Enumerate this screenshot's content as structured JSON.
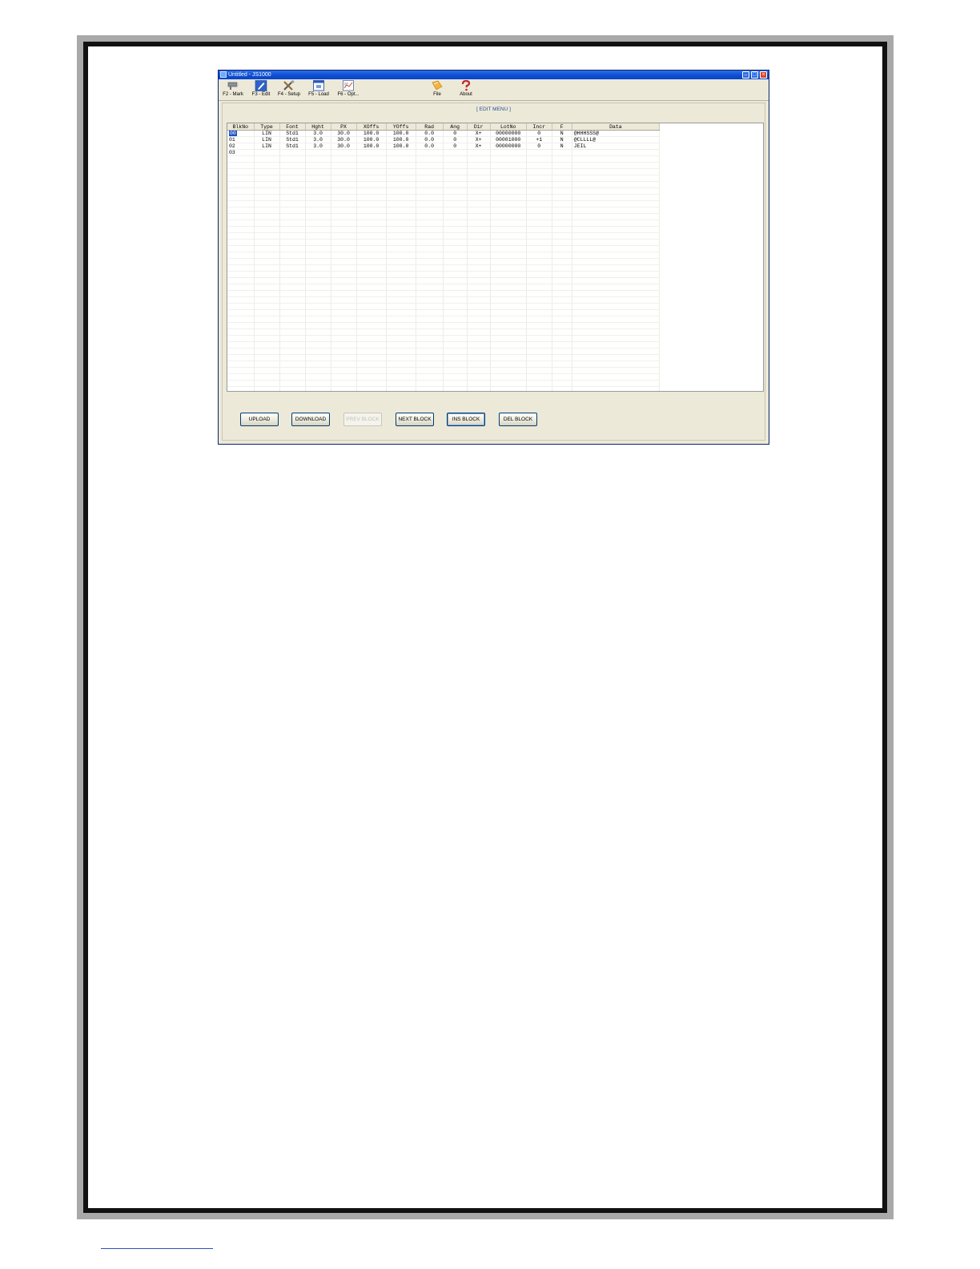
{
  "window": {
    "title": "Untitled - JS1000"
  },
  "toolbar": {
    "items": [
      {
        "label": "F2 - Mark",
        "icon": "marker-device-icon"
      },
      {
        "label": "F3 - Edit",
        "icon": "edit-pencil-icon"
      },
      {
        "label": "F4 - Setup",
        "icon": "tools-icon"
      },
      {
        "label": "F5 - Load",
        "icon": "load-window-icon"
      },
      {
        "label": "F6 - Opt...",
        "icon": "options-chart-icon"
      },
      {
        "label": "File",
        "icon": "folder-icon"
      },
      {
        "label": "About",
        "icon": "question-icon"
      }
    ]
  },
  "panel": {
    "title": "[ EDIT MENU ]"
  },
  "grid": {
    "columns": [
      "BlkNo",
      "Type",
      "Font",
      "Hght",
      "PX",
      "XOffs",
      "YOffs",
      "Rad",
      "Ang",
      "Dir",
      "LotNo",
      "Incr",
      "F",
      "Data"
    ],
    "rows": [
      [
        "00",
        "LIN",
        "Std1",
        "3.0",
        "30.0",
        "100.0",
        "100.0",
        "0.0",
        "0",
        "X+",
        "00000000",
        "0",
        "N",
        "@HHHSSS@"
      ],
      [
        "01",
        "LIN",
        "Std1",
        "3.0",
        "30.0",
        "100.0",
        "100.0",
        "0.0",
        "0",
        "X+",
        "00001000",
        "+1",
        "N",
        "@CLLLL@"
      ],
      [
        "02",
        "LIN",
        "Std1",
        "3.0",
        "30.0",
        "100.0",
        "100.0",
        "0.0",
        "0",
        "X+",
        "00000000",
        "0",
        "N",
        "JEIL"
      ],
      [
        "03",
        "",
        "",
        "",
        "",
        "",
        "",
        "",
        "",
        "",
        "",
        "",
        "",
        ""
      ]
    ],
    "selected_cell": "00"
  },
  "buttons": {
    "upload": "UPLOAD",
    "download": "DOWNLOAD",
    "prev_block": "PREV BLOCK",
    "next_block": "NEXT BLOCK",
    "ins_block": "INS BLOCK",
    "del_block": "DEL BLOCK"
  },
  "colors": {
    "titlebar": "#0a4fd6",
    "selection": "#1c4fc8",
    "window_face": "#ece9d8"
  }
}
